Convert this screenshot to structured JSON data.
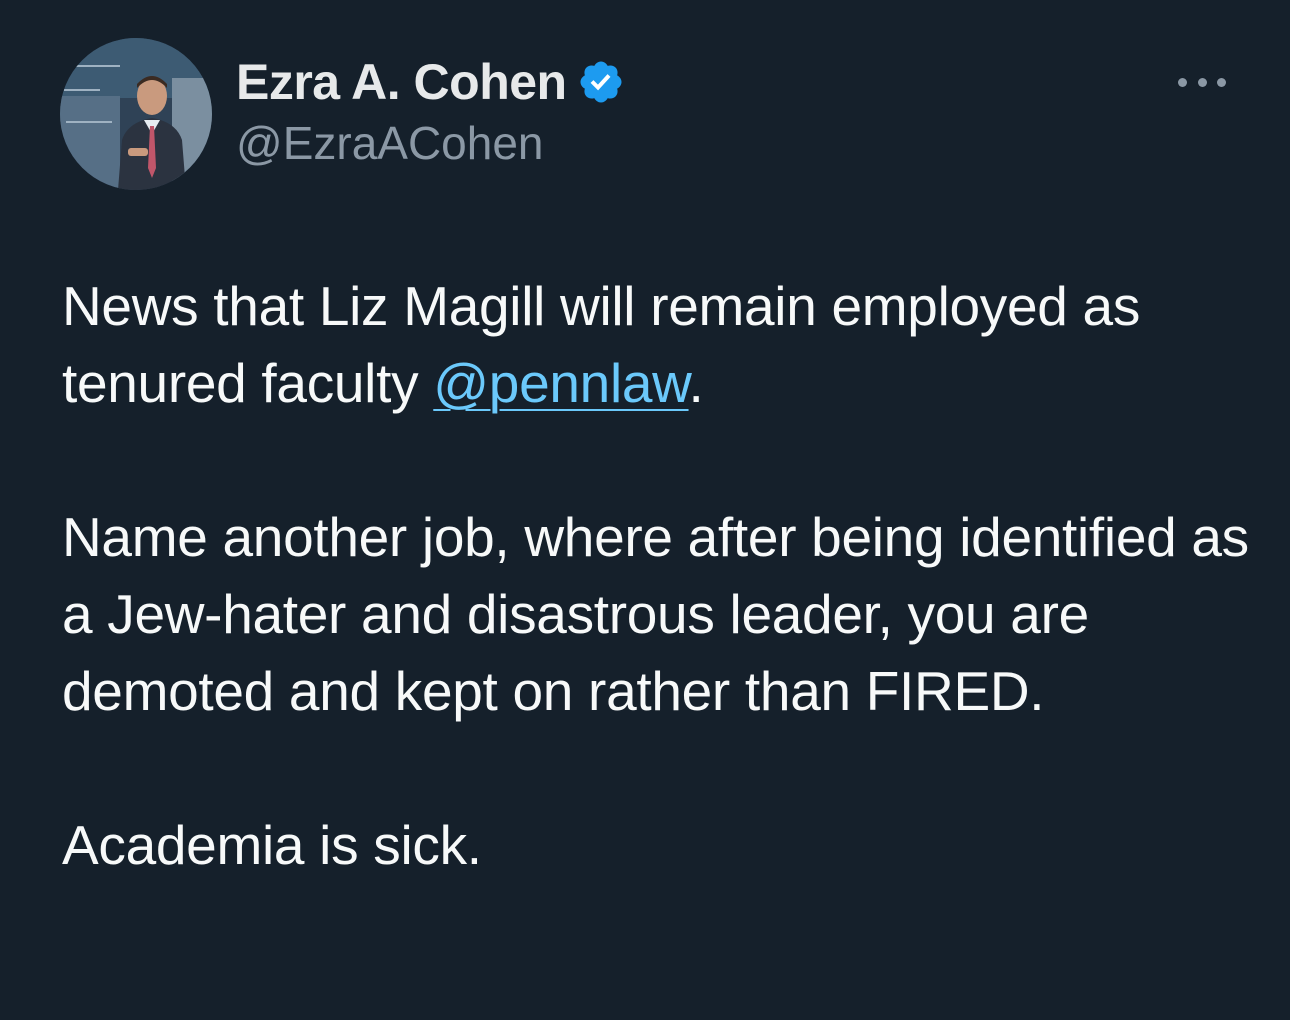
{
  "author": {
    "display_name": "Ezra A. Cohen",
    "handle": "@EzraACohen",
    "verified_icon": "verified-badge-icon",
    "verified_color": "#1d9bf0"
  },
  "more_icon": "more-options-icon",
  "tweet": {
    "p1_text": "News that Liz Magill will remain employed as tenured faculty ",
    "p1_mention": "@pennlaw",
    "p1_end": ".",
    "p2": "Name another job, where after being identified as a Jew-hater and disastrous leader, you are demoted and kept on rather than FIRED.",
    "p3": "Academia is sick."
  },
  "colors": {
    "background": "#15202b",
    "text": "#f7f9f9",
    "secondary_text": "#8b98a5",
    "mention": "#6bc9fb"
  }
}
